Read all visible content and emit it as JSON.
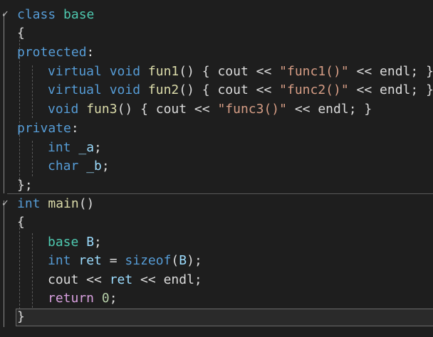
{
  "editor": {
    "language": "C++",
    "theme_colors": {
      "background": "#1e1e1e",
      "keyword": "#569cd6",
      "control_keyword": "#d8a0df",
      "type": "#4ec9b0",
      "function": "#dcdcaa",
      "string": "#d69d85",
      "number": "#b5cea8",
      "identifier": "#9cdcfe",
      "plain": "#dcdcdc"
    },
    "fold_icon": "check-mark-fold-icon",
    "lines": [
      {
        "tokens": [
          [
            "kw",
            "class"
          ],
          [
            "plain",
            " "
          ],
          [
            "type",
            "base"
          ]
        ]
      },
      {
        "tokens": [
          [
            "plain",
            "{"
          ]
        ]
      },
      {
        "tokens": [
          [
            "kw",
            "protected"
          ],
          [
            "plain",
            ":"
          ]
        ]
      },
      {
        "tokens": [
          [
            "kw",
            "virtual"
          ],
          [
            "plain",
            " "
          ],
          [
            "kw",
            "void"
          ],
          [
            "plain",
            " "
          ],
          [
            "func",
            "fun1"
          ],
          [
            "plain",
            "() { cout << "
          ],
          [
            "str",
            "\"func1()\""
          ],
          [
            "plain",
            " << endl; }"
          ]
        ]
      },
      {
        "tokens": [
          [
            "kw",
            "virtual"
          ],
          [
            "plain",
            " "
          ],
          [
            "kw",
            "void"
          ],
          [
            "plain",
            " "
          ],
          [
            "func",
            "fun2"
          ],
          [
            "plain",
            "() { cout << "
          ],
          [
            "str",
            "\"func2()\""
          ],
          [
            "plain",
            " << endl; }"
          ]
        ]
      },
      {
        "tokens": [
          [
            "kw",
            "void"
          ],
          [
            "plain",
            " "
          ],
          [
            "func",
            "fun3"
          ],
          [
            "plain",
            "() { cout << "
          ],
          [
            "str",
            "\"func3()\""
          ],
          [
            "plain",
            " << endl; }"
          ]
        ]
      },
      {
        "tokens": [
          [
            "kw",
            "private"
          ],
          [
            "plain",
            ":"
          ]
        ]
      },
      {
        "tokens": [
          [
            "kw",
            "int"
          ],
          [
            "plain",
            " "
          ],
          [
            "ident",
            "_a"
          ],
          [
            "plain",
            ";"
          ]
        ]
      },
      {
        "tokens": [
          [
            "kw",
            "char"
          ],
          [
            "plain",
            " "
          ],
          [
            "ident",
            "_b"
          ],
          [
            "plain",
            ";"
          ]
        ]
      },
      {
        "tokens": [
          [
            "plain",
            "};"
          ]
        ]
      },
      {
        "tokens": [
          [
            "kw",
            "int"
          ],
          [
            "plain",
            " "
          ],
          [
            "func",
            "main"
          ],
          [
            "plain",
            "()"
          ]
        ]
      },
      {
        "tokens": [
          [
            "plain",
            "{"
          ]
        ]
      },
      {
        "tokens": [
          [
            "type",
            "base"
          ],
          [
            "plain",
            " "
          ],
          [
            "ident",
            "B"
          ],
          [
            "plain",
            ";"
          ]
        ]
      },
      {
        "tokens": [
          [
            "kw",
            "int"
          ],
          [
            "plain",
            " "
          ],
          [
            "ident",
            "ret"
          ],
          [
            "plain",
            " = "
          ],
          [
            "kw",
            "sizeof"
          ],
          [
            "plain",
            "("
          ],
          [
            "ident",
            "B"
          ],
          [
            "plain",
            ");"
          ]
        ]
      },
      {
        "tokens": [
          [
            "plain",
            "cout << "
          ],
          [
            "ident",
            "ret"
          ],
          [
            "plain",
            " << endl;"
          ]
        ]
      },
      {
        "tokens": [
          [
            "kw-ctrl",
            "return"
          ],
          [
            "plain",
            " "
          ],
          [
            "num",
            "0"
          ],
          [
            "plain",
            ";"
          ]
        ]
      },
      {
        "tokens": [
          [
            "plain",
            "}"
          ]
        ]
      }
    ]
  }
}
